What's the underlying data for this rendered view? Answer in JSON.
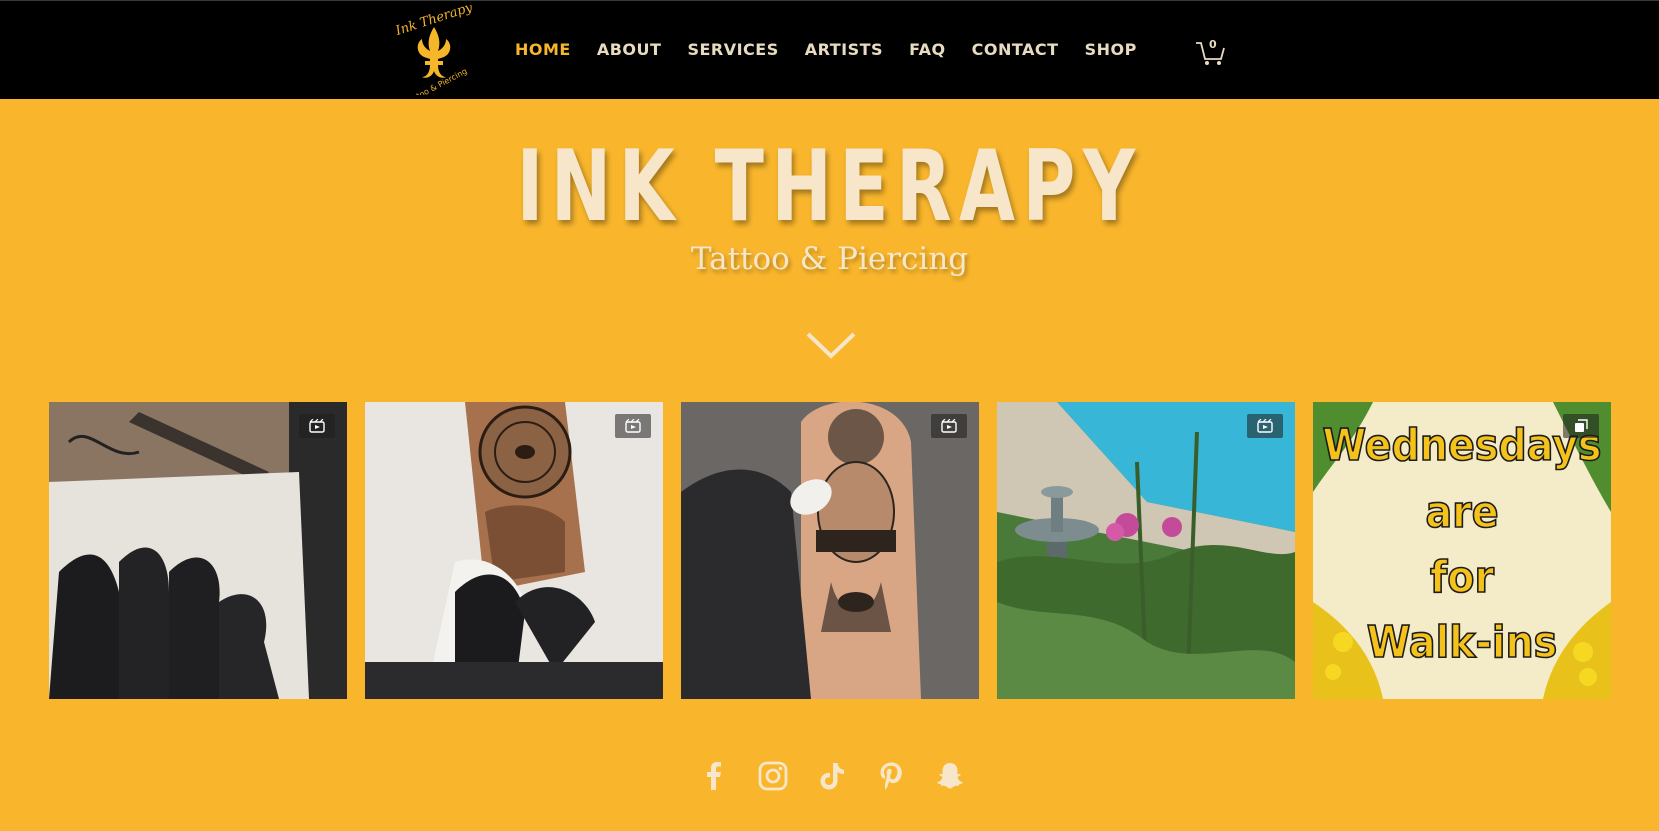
{
  "brand": {
    "logo_script": "Ink Therapy",
    "logo_subtext": "Tattoo & Piercing"
  },
  "nav": {
    "items": [
      {
        "label": "HOME",
        "active": true
      },
      {
        "label": "ABOUT",
        "active": false
      },
      {
        "label": "SERVICES",
        "active": false
      },
      {
        "label": "ARTISTS",
        "active": false
      },
      {
        "label": "FAQ",
        "active": false
      },
      {
        "label": "CONTACT",
        "active": false
      },
      {
        "label": "SHOP",
        "active": false
      }
    ],
    "cart_count": "0"
  },
  "hero": {
    "title": "INK THERAPY",
    "subtitle": "Tattoo & Piercing",
    "scroll_icon": "chevron-down-icon"
  },
  "gallery": {
    "tiles": [
      {
        "badge_icon": "reel-icon"
      },
      {
        "badge_icon": "reel-icon"
      },
      {
        "badge_icon": "reel-icon"
      },
      {
        "badge_icon": "reel-icon"
      },
      {
        "badge_icon": "carousel-icon",
        "poster_lines": [
          "Wednesdays",
          "are",
          "for",
          "Walk-ins"
        ]
      }
    ]
  },
  "social": {
    "icons": [
      "facebook-icon",
      "instagram-icon",
      "tiktok-icon",
      "pinterest-icon",
      "snapchat-icon"
    ]
  },
  "colors": {
    "background": "#f9b62c",
    "header": "#000000",
    "nav_text": "#e8dcc0",
    "nav_active": "#f5b62a",
    "hero_text": "#f7e6c9"
  }
}
